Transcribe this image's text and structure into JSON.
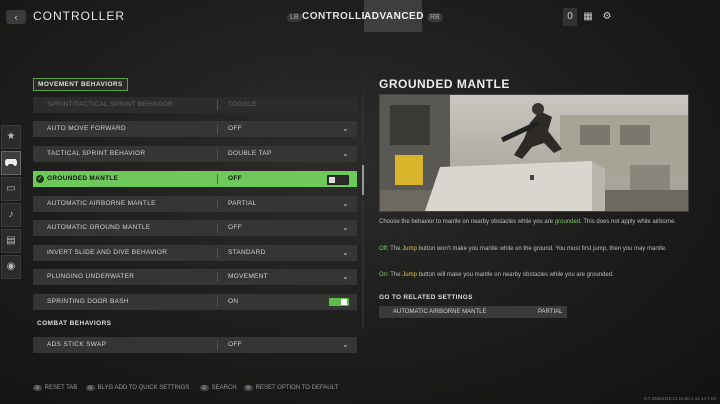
{
  "header": {
    "back_icon": "back-arrow-icon",
    "title": "CONTROLLER",
    "lb_hint": "LB",
    "rb_hint": "RB",
    "tabs": [
      {
        "label": "CONTROLLER",
        "active": false
      },
      {
        "label": "ADVANCED",
        "active": true
      }
    ],
    "right_icons": [
      "player-count-icon",
      "grid-menu-icon",
      "gear-icon"
    ],
    "player_count": "0"
  },
  "sidebar": {
    "items": [
      {
        "icon": "star-icon",
        "glyph": "★",
        "selected": false
      },
      {
        "icon": "controller-icon",
        "glyph": "🎮",
        "selected": true
      },
      {
        "icon": "interface-icon",
        "glyph": "▭",
        "selected": false
      },
      {
        "icon": "audio-icon",
        "glyph": "🔊",
        "selected": false
      },
      {
        "icon": "display-icon",
        "glyph": "▤",
        "selected": false
      },
      {
        "icon": "account-icon",
        "glyph": "◉",
        "selected": false
      }
    ]
  },
  "sections": {
    "movement": "MOVEMENT BEHAVIORS",
    "combat": "COMBAT BEHAVIORS"
  },
  "rows": [
    {
      "label": "SPRINT/TACTICAL SPRINT BEHAVIOR",
      "value": "TOGGLE",
      "kind": "disabled"
    },
    {
      "label": "AUTO MOVE FORWARD",
      "value": "OFF",
      "kind": "dropdown"
    },
    {
      "label": "TACTICAL SPRINT BEHAVIOR",
      "value": "DOUBLE TAP",
      "kind": "dropdown"
    },
    {
      "label": "GROUNDED MANTLE",
      "value": "OFF",
      "kind": "selected-toggle"
    },
    {
      "label": "AUTOMATIC AIRBORNE MANTLE",
      "value": "PARTIAL",
      "kind": "dropdown"
    },
    {
      "label": "AUTOMATIC GROUND MANTLE",
      "value": "OFF",
      "kind": "dropdown"
    },
    {
      "label": "INVERT SLIDE AND DIVE BEHAVIOR",
      "value": "STANDARD",
      "kind": "dropdown"
    },
    {
      "label": "PLUNGING UNDERWATER",
      "value": "MOVEMENT",
      "kind": "dropdown"
    },
    {
      "label": "SPRINTING DOOR BASH",
      "value": "ON",
      "kind": "toggle-on"
    },
    {
      "label": "ADS STICK SWAP",
      "value": "OFF",
      "kind": "dropdown"
    }
  ],
  "detail": {
    "title": "GROUNDED MANTLE",
    "desc_pre": "Choose the behavior to mantle on nearby obstacles while you are ",
    "desc_hl": "grounded",
    "desc_post": ". This does not apply while airborne.",
    "off_label": "Off:",
    "off_the": " The ",
    "off_jump": "Jump",
    "off_text": " button won't make you mantle while on the ground. You must first jump, then you may mantle.",
    "on_label": "On:",
    "on_the": " The ",
    "on_jump": "Jump",
    "on_text": " button will make you mantle on nearby obstacles while you are grounded.",
    "related_title": "GO TO RELATED SETTINGS",
    "related_label": "AUTOMATIC AIRBORNE MANTLE",
    "related_value": "PARTIAL"
  },
  "footer": [
    {
      "button": "⊙",
      "label": "RESET TAB"
    },
    {
      "button": "⊙",
      "label": "BLYG ADD TO QUICK SETTINGS"
    },
    {
      "button": "⊙",
      "label": "SEARCH"
    },
    {
      "button": "⊙",
      "label": "RESET OPTION TO DEFAULT"
    }
  ],
  "build_info": "9.7.15684110.11.16.50.1.14.14.7.03",
  "colors": {
    "accent_green": "#6fc85a",
    "highlight_yellow": "#e3c44c"
  }
}
